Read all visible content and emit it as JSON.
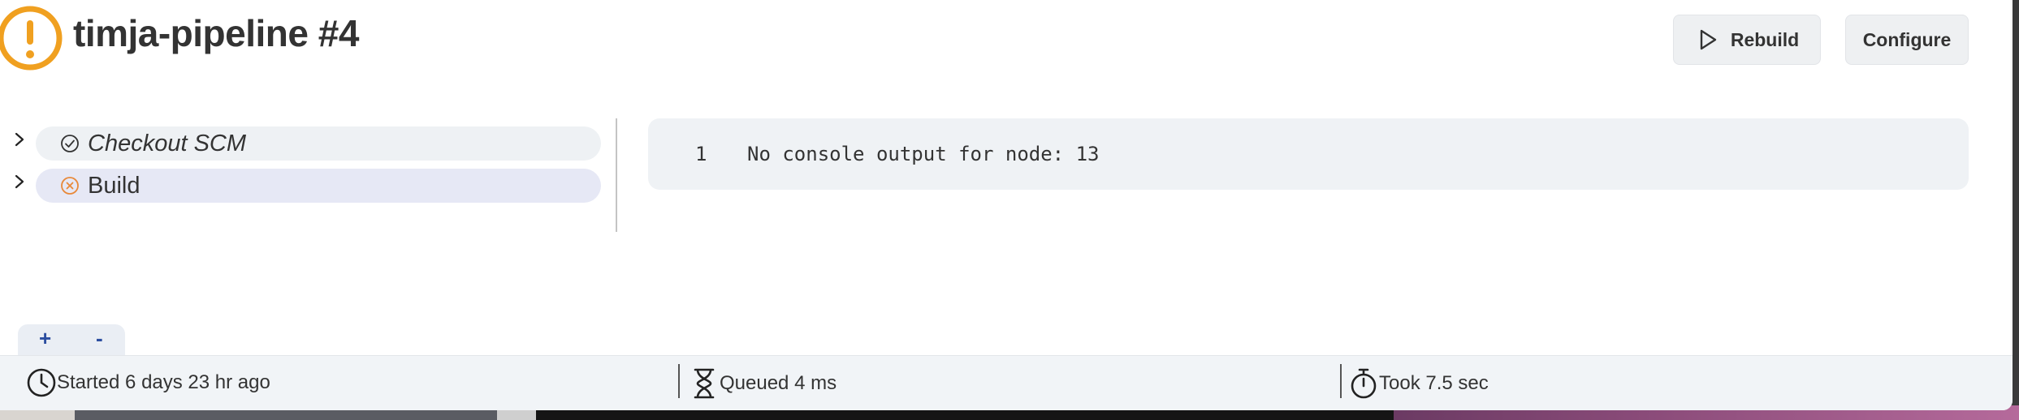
{
  "build": {
    "title": "timja-pipeline #4",
    "status": "unstable",
    "status_color": "#f0a020"
  },
  "actions": {
    "rebuild_label": "Rebuild",
    "configure_label": "Configure"
  },
  "stages": [
    {
      "label": "Checkout SCM",
      "status": "success",
      "icon": "check-circle-icon"
    },
    {
      "label": "Build",
      "status": "failed",
      "icon": "x-circle-icon",
      "status_color": "#e8893a",
      "selected": true
    }
  ],
  "console": {
    "lines": [
      {
        "number": "1",
        "text": "No console output for node: 13"
      }
    ]
  },
  "zoom": {
    "in_label": "+",
    "out_label": "-"
  },
  "footer": {
    "started": "Started 6 days 23 hr ago",
    "queued": "Queued 4 ms",
    "took": "Took 7.5 sec"
  }
}
